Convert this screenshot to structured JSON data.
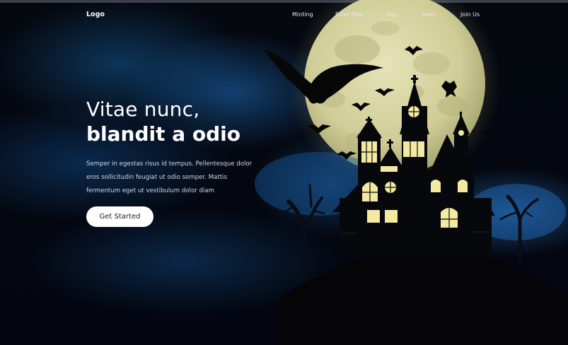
{
  "nav": {
    "logo": "Logo",
    "links": [
      "Minting",
      "Road Map",
      "Faq",
      "Team",
      "Join Us"
    ]
  },
  "hero": {
    "title_line1": "Vitae nunc,",
    "title_line2": "blandit a odio",
    "description": "Semper in egestas risus id tempus. Pellentesque dolor eros sollicitudin feugiat ut odio semper. Mattis fermentum eget ut vestibulum dolor diam",
    "cta_label": "Get Started"
  },
  "colors": {
    "background": "#03060d",
    "moon": "#d9d7a6",
    "window_light": "#f3e9a0",
    "fog": "#1e6eb4"
  },
  "icons": [
    "moon-icon",
    "bat-icon",
    "haunted-house-icon",
    "dead-tree-icon"
  ]
}
